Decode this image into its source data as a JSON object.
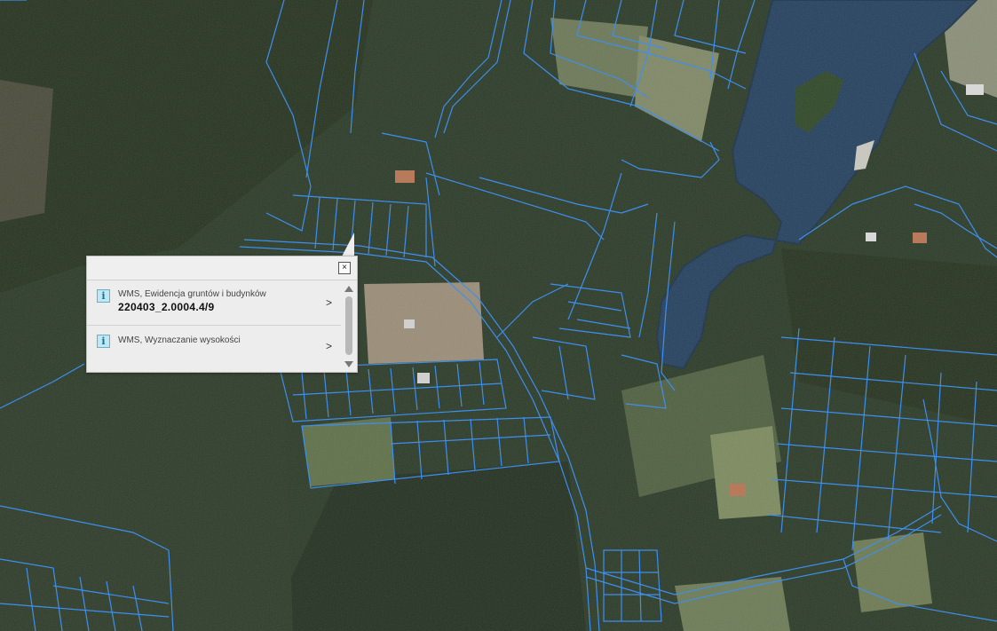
{
  "popup": {
    "close_label": "×",
    "items": [
      {
        "title": "WMS, Ewidencja gruntów i budynków",
        "value": "220403_2.0004.4/9",
        "icon": "info-icon",
        "arrow": ">"
      },
      {
        "title": "WMS, Wyznaczanie wysokości",
        "value": "",
        "icon": "info-icon",
        "arrow": ">"
      }
    ]
  },
  "colors": {
    "parcel_lines": "#3d8ff0",
    "water": "#25405e",
    "forest": "#1f2c1c",
    "field": "#7d8a66",
    "popup_bg": "#ededed"
  }
}
